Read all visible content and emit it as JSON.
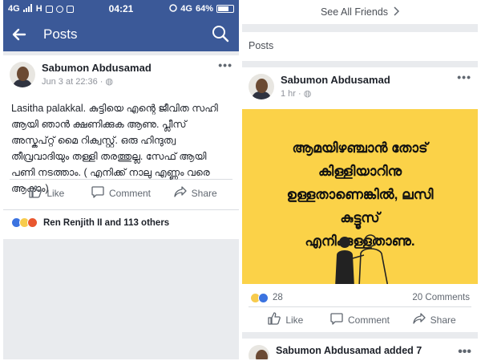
{
  "status_bar": {
    "network_left": "4G",
    "signal_left": "H",
    "time": "04:21",
    "network_right": "4G",
    "battery": "64%"
  },
  "app_bar": {
    "title": "Posts",
    "back_icon": "arrow-left-icon",
    "search_icon": "search-icon"
  },
  "left_post": {
    "author": "Sabumon Abdusamad",
    "timestamp": "Jun 3 at 22:36",
    "privacy_icon": "globe-icon",
    "text": "Lasitha palakkal. കുട്ടിയെ എന്റെ ജീവിത സഹി ആയി ഞാൻ ക്ഷണിക്കുക ആണു. പ്ലീസ് അസ്കപ്റ്റ് മൈ റിക്വസ്റ്റ്. ഒരു ഹിന്ദുത്വ തീവ്രവാദിയും തള്ളി തരത്തുല്ല. സേഫ് ആയി പണി നടത്താം. ( എനിക്ക് നാലു എണ്ണം വരെ ആകാം)",
    "actions": {
      "like": "Like",
      "comment": "Comment",
      "share": "Share"
    },
    "reactions_text": "Ren Renjith II and 113 others"
  },
  "right_panel": {
    "see_all": "See All Friends",
    "section_title": "Posts",
    "post": {
      "author": "Sabumon Abdusamad",
      "timestamp": "1 hr",
      "banner_lines": [
        "ആമയിഴഞ്ചാൻ തോട്",
        "കിള്ളിയാറിനു",
        "ഉള്ളതാണെങ്കിൽ, ലസി",
        "കുട്ടൂസ്",
        "എനിക്കുള്ളതാണു."
      ],
      "banner_color": "#fbd248",
      "reaction_count": "28",
      "comments": "20 Comments",
      "actions": {
        "like": "Like",
        "comment": "Comment",
        "share": "Share"
      }
    },
    "next_post_author": "Sabumon Abdusamad added 7"
  },
  "colors": {
    "brand": "#3b5998",
    "background": "#e9ebee"
  }
}
